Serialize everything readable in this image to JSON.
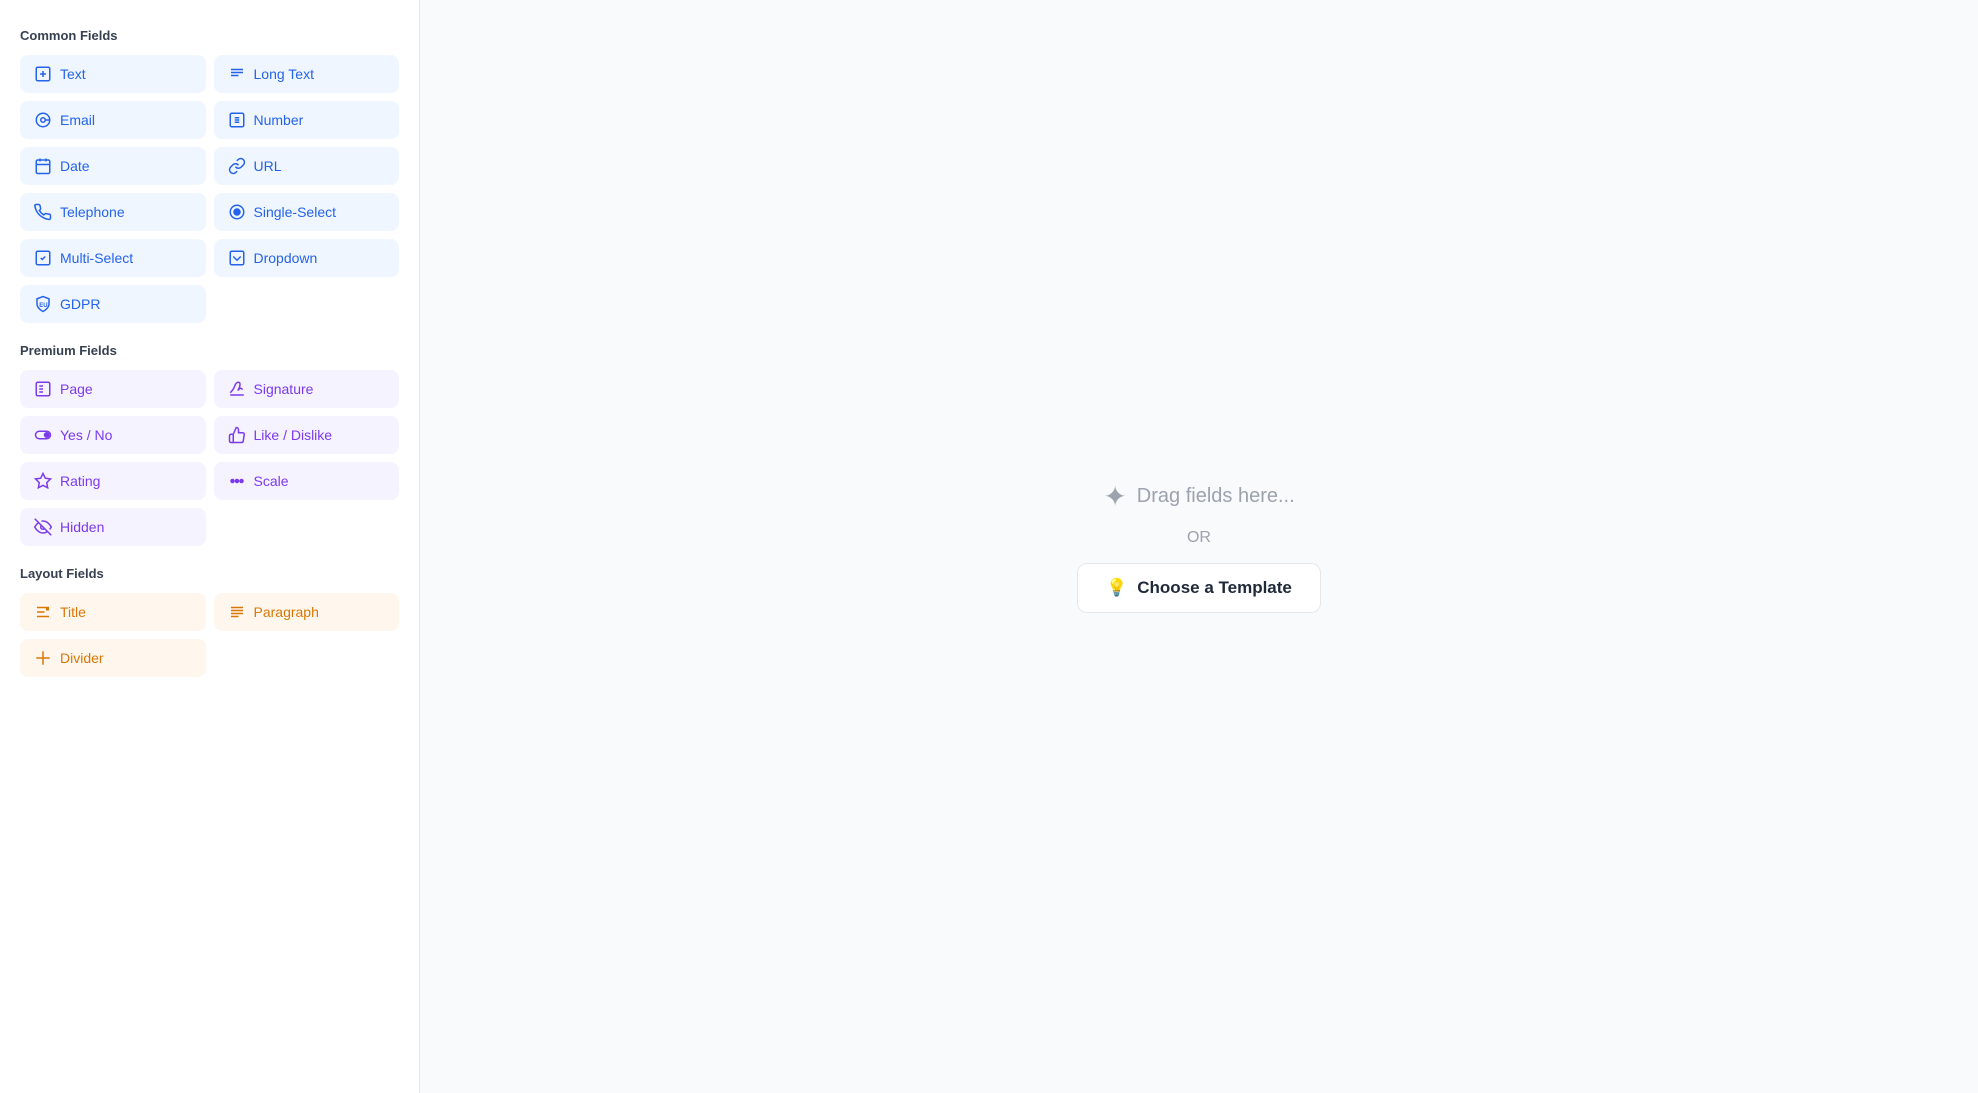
{
  "sidebar": {
    "sections": [
      {
        "id": "common",
        "label": "Common Fields",
        "type": "common",
        "fields": [
          {
            "id": "text",
            "label": "Text",
            "icon": "🅰"
          },
          {
            "id": "long-text",
            "label": "Long Text",
            "icon": "📝"
          },
          {
            "id": "email",
            "label": "Email",
            "icon": "📧"
          },
          {
            "id": "number",
            "label": "Number",
            "icon": "🔢"
          },
          {
            "id": "date",
            "label": "Date",
            "icon": "📅"
          },
          {
            "id": "url",
            "label": "URL",
            "icon": "🔗"
          },
          {
            "id": "telephone",
            "label": "Telephone",
            "icon": "📞"
          },
          {
            "id": "single-select",
            "label": "Single-Select",
            "icon": "🎯"
          },
          {
            "id": "multi-select",
            "label": "Multi-Select",
            "icon": "☑"
          },
          {
            "id": "dropdown",
            "label": "Dropdown",
            "icon": "📋"
          },
          {
            "id": "gdpr",
            "label": "GDPR",
            "icon": "🛡"
          }
        ]
      },
      {
        "id": "premium",
        "label": "Premium Fields",
        "type": "premium",
        "fields": [
          {
            "id": "page",
            "label": "Page",
            "icon": "📄"
          },
          {
            "id": "signature",
            "label": "Signature",
            "icon": "✍"
          },
          {
            "id": "yes-no",
            "label": "Yes / No",
            "icon": "⬤"
          },
          {
            "id": "like-dislike",
            "label": "Like / Dislike",
            "icon": "👍"
          },
          {
            "id": "rating",
            "label": "Rating",
            "icon": "⭐"
          },
          {
            "id": "scale",
            "label": "Scale",
            "icon": "⠿"
          },
          {
            "id": "hidden",
            "label": "Hidden",
            "icon": "🚫"
          }
        ]
      },
      {
        "id": "layout",
        "label": "Layout Fields",
        "type": "layout",
        "fields": [
          {
            "id": "title",
            "label": "Title",
            "icon": "T"
          },
          {
            "id": "paragraph",
            "label": "Paragraph",
            "icon": "≡"
          },
          {
            "id": "divider",
            "label": "Divider",
            "icon": "⊕"
          }
        ]
      }
    ]
  },
  "main": {
    "drag_hint": "Drag fields here...",
    "or_label": "OR",
    "template_button_label": "Choose a Template",
    "template_button_icon": "💡"
  }
}
